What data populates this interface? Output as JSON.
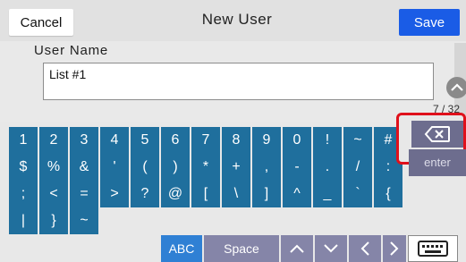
{
  "header": {
    "cancel_label": "Cancel",
    "title": "New User",
    "save_label": "Save"
  },
  "form": {
    "field_label": "User Name",
    "field_value": "List #1",
    "char_counter": "7 / 32"
  },
  "keyboard": {
    "row1": [
      "1",
      "2",
      "3",
      "4",
      "5",
      "6",
      "7",
      "8",
      "9",
      "0",
      "!",
      "~",
      "#"
    ],
    "row2": [
      "$",
      "%",
      "&",
      "'",
      "(",
      ")",
      "*",
      "+",
      ",",
      "-",
      ".",
      "/",
      ":"
    ],
    "row3": [
      ";",
      "<",
      "=",
      ">",
      "?",
      "@",
      "[",
      "\\",
      "]",
      "^",
      "_",
      "`",
      "{"
    ],
    "row4": [
      "|",
      "}",
      "~"
    ],
    "backspace_icon": "backspace-icon",
    "enter_label": "enter",
    "abc_label": "ABC",
    "space_label": "Space",
    "keyboard_icon": "keyboard-icon"
  },
  "colors": {
    "key_blue": "#1f6f9d",
    "save_blue": "#1a5ce6",
    "function_key": "#8585a8",
    "highlight_red": "#e0101b"
  }
}
